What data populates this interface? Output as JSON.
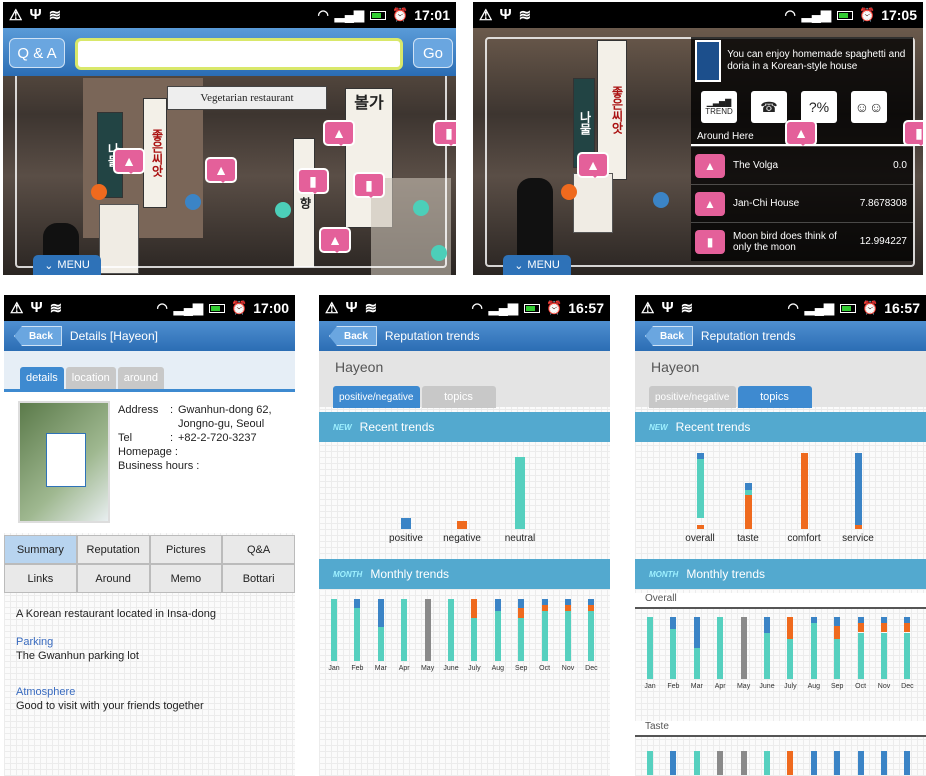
{
  "colors": {
    "positive": "#3b84c6",
    "negative": "#ef6a1e",
    "neutral": "#56d0bf",
    "gray": "#8a8a8a",
    "accent": "#2e72b8"
  },
  "screen1": {
    "time": "17:01",
    "qa_label": "Q & A",
    "go_label": "Go",
    "menu_label": "MENU",
    "restaurant_sign": "Vegetarian restaurant"
  },
  "screen2": {
    "time": "17:05",
    "menu_label": "MENU",
    "promo_text": "You can enjoy homemade spaghetti and doria in a Korean-style house",
    "tool_icons": [
      "trend-icon",
      "phone-icon",
      "price-icon",
      "people-icon"
    ],
    "trend_label": "TREND",
    "around_here": "Around Here",
    "places": [
      {
        "name": "The Volga",
        "value": "0.0"
      },
      {
        "name": "Jan-Chi House",
        "value": "7.8678308"
      },
      {
        "name": "Moon bird does think of only the moon",
        "value": "12.994227"
      }
    ]
  },
  "screen3": {
    "time": "17:00",
    "back": "Back",
    "title": "Details [Hayeon]",
    "tabs": [
      "details",
      "location",
      "around"
    ],
    "address_label": "Address",
    "address_value": "Gwanhun-dong 62, Jongno-gu, Seoul",
    "tel_label": "Tel",
    "tel_value": "+82-2-720-3237",
    "homepage_label": "Homepage :",
    "hours_label": "Business hours :",
    "buttons": [
      "Summary",
      "Reputation",
      "Pictures",
      "Q&A",
      "Links",
      "Around",
      "Memo",
      "Bottari"
    ],
    "summary": "A Korean restaurant located in Insa-dong",
    "parking_h": "Parking",
    "parking_v": "The Gwanhun parking lot",
    "atmos_h": "Atmosphere",
    "atmos_v": "Good to visit with your friends together"
  },
  "screen4": {
    "time": "16:57",
    "back": "Back",
    "title": "Reputation trends",
    "place": "Hayeon",
    "tabs": [
      "positive/negative",
      "topics"
    ],
    "recent_badge": "NEW",
    "recent": "Recent trends",
    "monthly_badge": "MONTH",
    "monthly": "Monthly trends"
  },
  "screen5": {
    "time": "16:57",
    "back": "Back",
    "title": "Reputation trends",
    "place": "Hayeon",
    "tabs": [
      "positive/negative",
      "topics"
    ],
    "recent_badge": "NEW",
    "recent": "Recent trends",
    "monthly_badge": "MONTH",
    "monthly": "Monthly trends",
    "sub1": "Overall",
    "sub2": "Taste"
  },
  "chart_data": [
    {
      "type": "bar",
      "categories": [
        "positive",
        "negative",
        "neutral"
      ],
      "values": [
        0.14,
        0.1,
        0.95
      ],
      "colors": [
        "#3b84c6",
        "#ef6a1e",
        "#56d0bf"
      ]
    },
    {
      "type": "bar",
      "stacked": true,
      "categories": [
        "Jan",
        "Feb",
        "Mar",
        "Apr",
        "May",
        "June",
        "July",
        "Aug",
        "Sep",
        "Oct",
        "Nov",
        "Dec"
      ],
      "series": [
        {
          "values": [
            0,
            0.15,
            0.45,
            0,
            0,
            0,
            0,
            0.2,
            0.15,
            0.1,
            0.1,
            0.1
          ]
        },
        {
          "values": [
            0,
            0,
            0,
            0,
            1,
            0,
            0,
            0,
            0,
            0,
            0,
            0
          ]
        },
        {
          "values": [
            0,
            0,
            0,
            0,
            0,
            0,
            0.3,
            0,
            0.15,
            0.1,
            0.1,
            0.1
          ]
        },
        {
          "values": [
            1,
            0.85,
            0.55,
            1,
            0,
            1,
            0.7,
            0.8,
            0.7,
            0.8,
            0.8,
            0.8
          ]
        }
      ]
    },
    {
      "type": "bar",
      "stacked": true,
      "categories": [
        "overall",
        "taste",
        "comfort",
        "service"
      ],
      "series": [
        {
          "values": [
            0.05,
            0.45,
            1,
            0.05
          ]
        },
        {
          "values": [
            0.1,
            0,
            0,
            0
          ]
        },
        {
          "values": [
            0.85,
            0.15,
            0,
            0.95
          ]
        }
      ]
    },
    {
      "type": "bar",
      "stacked": true,
      "categories": [
        "Jan",
        "Feb",
        "Mar",
        "Apr",
        "May",
        "June",
        "July",
        "Aug",
        "Sep",
        "Oct",
        "Nov",
        "Dec"
      ],
      "series": [
        {
          "values": [
            0,
            0.2,
            0.5,
            0,
            0,
            0.25,
            0,
            0.1,
            0.15,
            0.1,
            0.1,
            0.1
          ]
        },
        {
          "values": [
            0,
            0,
            0,
            0,
            1,
            0,
            0,
            0,
            0,
            0,
            0,
            0
          ]
        },
        {
          "values": [
            0,
            0,
            0,
            0,
            0,
            0,
            0.35,
            0,
            0.2,
            0.15,
            0.15,
            0.15
          ]
        },
        {
          "values": [
            1,
            0.8,
            0.5,
            1,
            0,
            0.75,
            0.65,
            0.9,
            0.65,
            0.75,
            0.75,
            0.75
          ]
        }
      ]
    }
  ]
}
